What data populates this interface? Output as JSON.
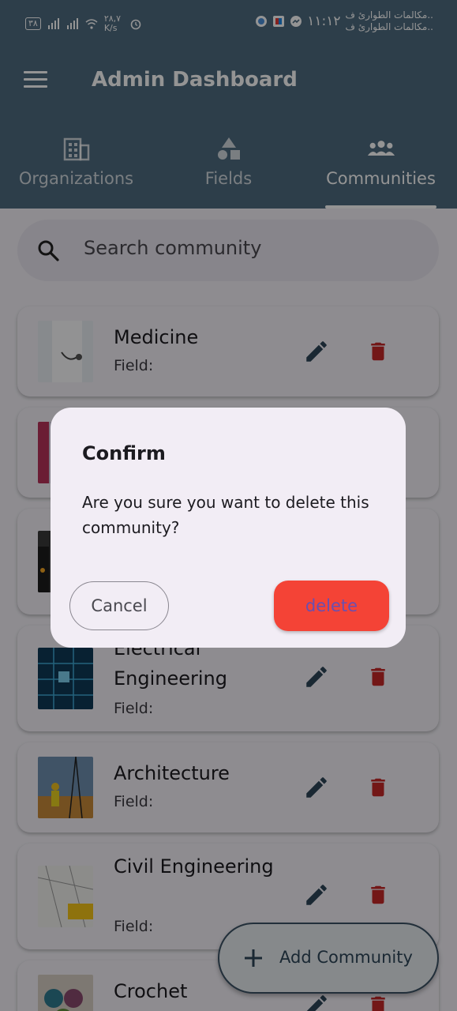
{
  "status_bar": {
    "battery": "٣٨",
    "speed": "٢٨,٧ K/s",
    "time": "١١:١٢",
    "carrier_line1": "مكالمات الطوارئ ف..",
    "carrier_line2": "مكالمات الطوارئ ف.."
  },
  "app_bar": {
    "title": "Admin Dashboard"
  },
  "tabs": [
    {
      "label": "Organizations",
      "icon": "building-icon",
      "active": false
    },
    {
      "label": "Fields",
      "icon": "shapes-icon",
      "active": false
    },
    {
      "label": "Communities",
      "icon": "group-icon",
      "active": true
    }
  ],
  "search": {
    "placeholder": "Search community"
  },
  "communities": [
    {
      "name": "Medicine",
      "field_label": "Field:"
    },
    {
      "name": "",
      "field_label": ""
    },
    {
      "name": "",
      "field_label": ""
    },
    {
      "name": "Electrical Engineering",
      "field_label": "Field:"
    },
    {
      "name": "Architecture",
      "field_label": "Field:"
    },
    {
      "name": "Civil Engineering",
      "field_label": "Field:"
    },
    {
      "name": "Crochet",
      "field_label": ""
    }
  ],
  "fab": {
    "label": "Add Community"
  },
  "dialog": {
    "title": "Confirm",
    "message": "Are you sure you want to delete this community?",
    "cancel_label": "Cancel",
    "delete_label": "delete"
  },
  "colors": {
    "app_bar": "#4e6b80",
    "accent": "#2d4659",
    "danger": "#f44336",
    "delete_icon": "#c62828"
  }
}
